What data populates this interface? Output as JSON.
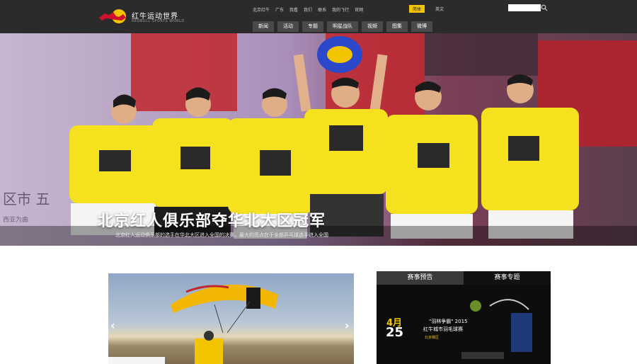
{
  "header": {
    "logo_text": "红牛运动世界",
    "logo_sub": "REDBULL SPORTS WORLD",
    "toplinks": [
      "北京红牛",
      "广东",
      "我看",
      "我们",
      "联系",
      "我的飞行",
      "官网"
    ],
    "lang": [
      {
        "label": "简体",
        "active": true
      },
      {
        "label": "英文",
        "active": false
      }
    ],
    "search_placeholder": ""
  },
  "nav": [
    "新闻",
    "活动",
    "专题",
    "明星战队",
    "视频",
    "图集",
    "微博"
  ],
  "hero": {
    "caption": "北京红人俱乐部夺华北大区冠军",
    "subcaption": "北京红人运动俱乐部的选手在华北大区进入全国的决赛，最大的亮点在于全部乒乓球选手进入全国",
    "background_text_1": "区市 五",
    "background_text_2": "西亚为曲"
  },
  "panel_right": {
    "tabs": [
      {
        "label": "赛事预告",
        "active": true
      },
      {
        "label": "赛事专题",
        "active": false
      }
    ],
    "event_month": "4月",
    "event_day": "25",
    "event_title_1": "\"羽林争霸\" 2015",
    "event_title_2": "红牛城市羽毛球赛",
    "event_tag": "北京赛区"
  },
  "colors": {
    "header_bg": "#2b2b2b",
    "accent_yellow": "#f2c500",
    "redbull_red": "#d0112b"
  }
}
